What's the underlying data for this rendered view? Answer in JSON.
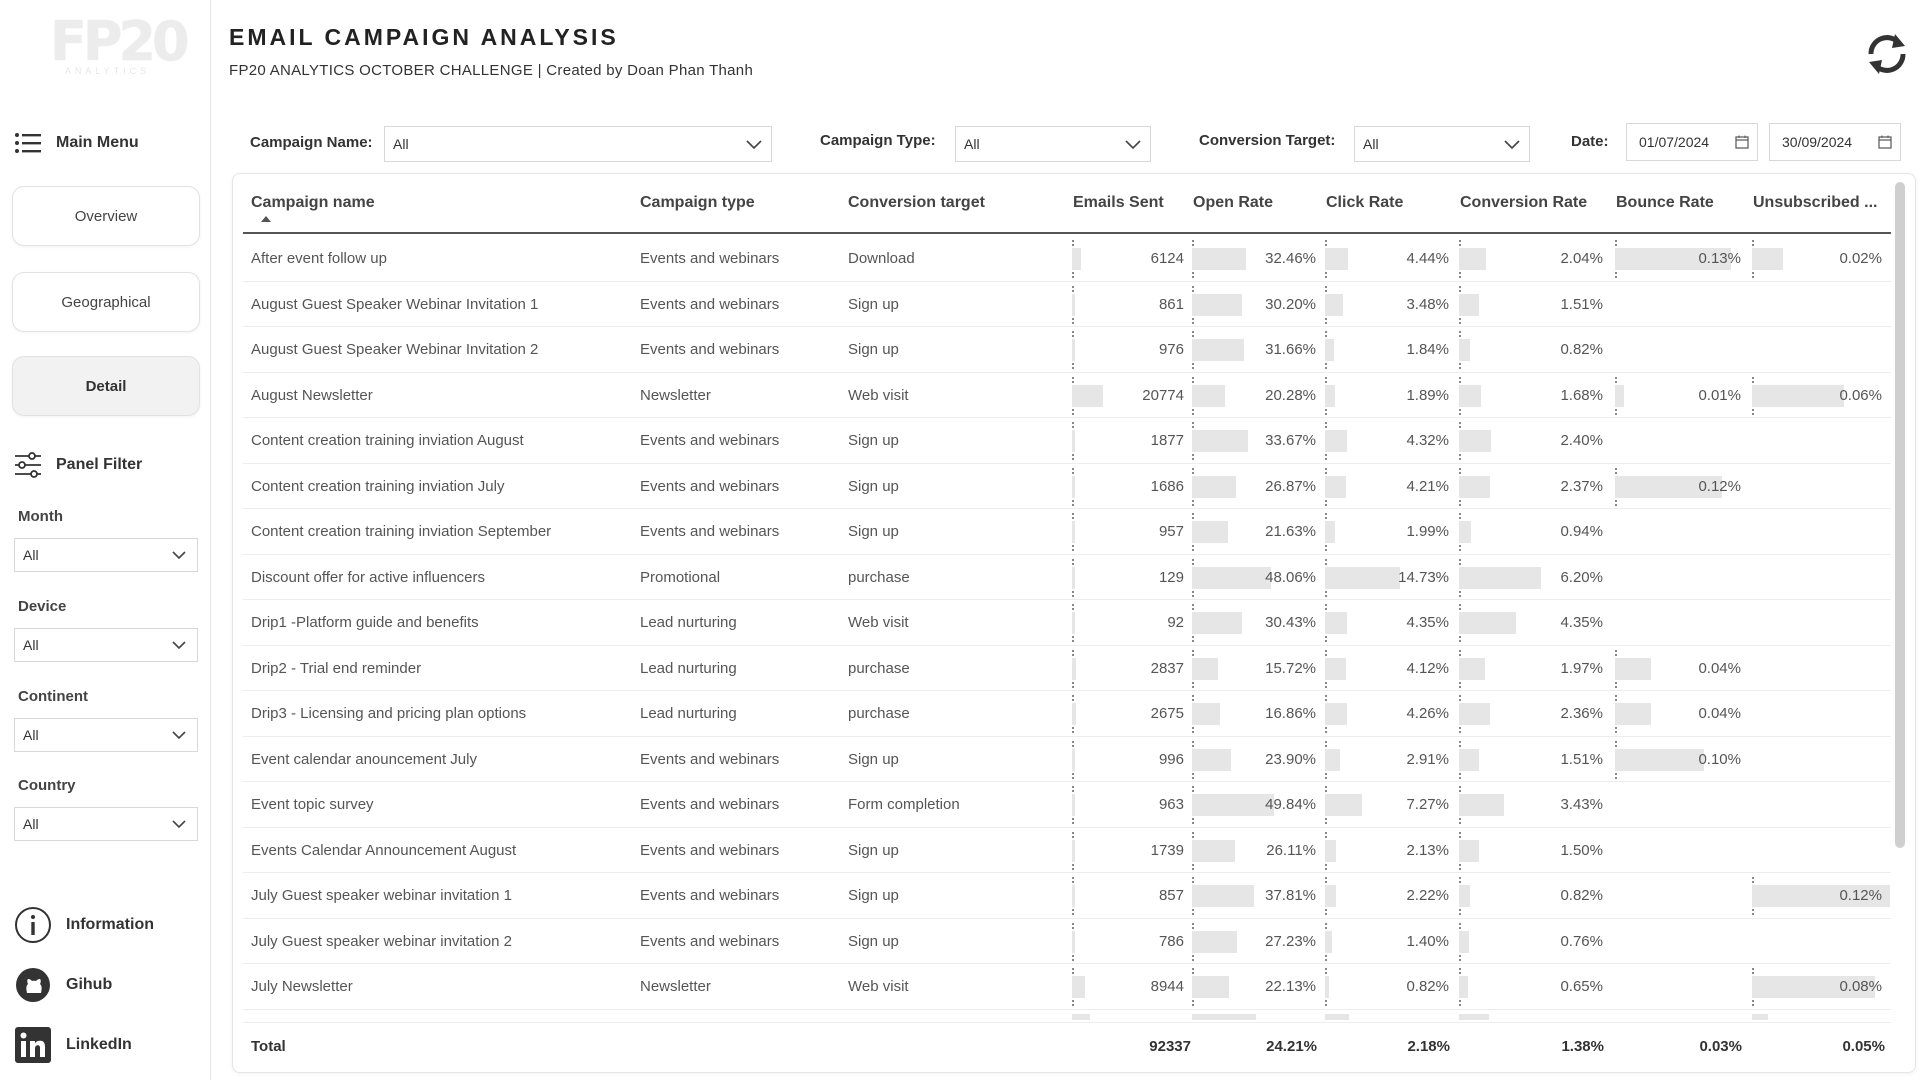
{
  "header": {
    "logo_text": "FP20",
    "logo_sub": "ANALYTICS",
    "title": "EMAIL CAMPAIGN ANALYSIS",
    "subtitle": "FP20 ANALYTICS OCTOBER CHALLENGE | Created by Doan Phan Thanh",
    "refresh_icon": "refresh-icon"
  },
  "sidebar": {
    "main_menu": "Main Menu",
    "nav": [
      {
        "label": "Overview",
        "active": false
      },
      {
        "label": "Geographical",
        "active": false
      },
      {
        "label": "Detail",
        "active": true
      }
    ],
    "panel_filter": "Panel Filter",
    "filters": [
      {
        "label": "Month",
        "value": "All"
      },
      {
        "label": "Device",
        "value": "All"
      },
      {
        "label": "Continent",
        "value": "All"
      },
      {
        "label": "Country",
        "value": "All"
      }
    ],
    "links": [
      {
        "label": "Information",
        "icon": "info-icon"
      },
      {
        "label": "Gihub",
        "icon": "github-icon"
      },
      {
        "label": "LinkedIn",
        "icon": "linkedin-icon"
      }
    ]
  },
  "filterbar": {
    "campaign_name_label": "Campaign Name:",
    "campaign_name_value": "All",
    "campaign_type_label": "Campaign Type:",
    "campaign_type_value": "All",
    "conversion_target_label": "Conversion Target:",
    "conversion_target_value": "All",
    "date_label": "Date:",
    "date_from": "01/07/2024",
    "date_to": "30/09/2024"
  },
  "table": {
    "columns": [
      "Campaign name",
      "Campaign type",
      "Conversion target",
      "Emails Sent",
      "Open Rate",
      "Click Rate",
      "Conversion Rate",
      "Bounce Rate",
      "Unsubscribed ..."
    ],
    "rows": [
      {
        "name": "After event follow up",
        "type": "Events and webinars",
        "target": "Download",
        "sent": 6124,
        "sent_t": "6124",
        "open": 32.46,
        "open_t": "32.46%",
        "click": 4.44,
        "click_t": "4.44%",
        "conv": 2.04,
        "conv_t": "2.04%",
        "bounce": 0.13,
        "bounce_t": "0.13%",
        "unsub": 0.02,
        "unsub_t": "0.02%"
      },
      {
        "name": "August Guest Speaker Webinar Invitation 1",
        "type": "Events and webinars",
        "target": "Sign up",
        "sent": 861,
        "sent_t": "861",
        "open": 30.2,
        "open_t": "30.20%",
        "click": 3.48,
        "click_t": "3.48%",
        "conv": 1.51,
        "conv_t": "1.51%",
        "bounce": null,
        "bounce_t": "",
        "unsub": null,
        "unsub_t": ""
      },
      {
        "name": "August Guest Speaker Webinar Invitation 2",
        "type": "Events and webinars",
        "target": "Sign up",
        "sent": 976,
        "sent_t": "976",
        "open": 31.66,
        "open_t": "31.66%",
        "click": 1.84,
        "click_t": "1.84%",
        "conv": 0.82,
        "conv_t": "0.82%",
        "bounce": null,
        "bounce_t": "",
        "unsub": null,
        "unsub_t": ""
      },
      {
        "name": "August Newsletter",
        "type": "Newsletter",
        "target": "Web visit",
        "sent": 20774,
        "sent_t": "20774",
        "open": 20.28,
        "open_t": "20.28%",
        "click": 1.89,
        "click_t": "1.89%",
        "conv": 1.68,
        "conv_t": "1.68%",
        "bounce": 0.01,
        "bounce_t": "0.01%",
        "unsub": 0.06,
        "unsub_t": "0.06%"
      },
      {
        "name": "Content creation training inviation August",
        "type": "Events and webinars",
        "target": "Sign up",
        "sent": 1877,
        "sent_t": "1877",
        "open": 33.67,
        "open_t": "33.67%",
        "click": 4.32,
        "click_t": "4.32%",
        "conv": 2.4,
        "conv_t": "2.40%",
        "bounce": null,
        "bounce_t": "",
        "unsub": null,
        "unsub_t": ""
      },
      {
        "name": "Content creation training inviation July",
        "type": "Events and webinars",
        "target": "Sign up",
        "sent": 1686,
        "sent_t": "1686",
        "open": 26.87,
        "open_t": "26.87%",
        "click": 4.21,
        "click_t": "4.21%",
        "conv": 2.37,
        "conv_t": "2.37%",
        "bounce": 0.12,
        "bounce_t": "0.12%",
        "unsub": null,
        "unsub_t": ""
      },
      {
        "name": "Content creation training inviation September",
        "type": "Events and webinars",
        "target": "Sign up",
        "sent": 957,
        "sent_t": "957",
        "open": 21.63,
        "open_t": "21.63%",
        "click": 1.99,
        "click_t": "1.99%",
        "conv": 0.94,
        "conv_t": "0.94%",
        "bounce": null,
        "bounce_t": "",
        "unsub": null,
        "unsub_t": ""
      },
      {
        "name": "Discount offer for active influencers",
        "type": "Promotional",
        "target": "purchase",
        "sent": 129,
        "sent_t": "129",
        "open": 48.06,
        "open_t": "48.06%",
        "click": 14.73,
        "click_t": "14.73%",
        "conv": 6.2,
        "conv_t": "6.20%",
        "bounce": null,
        "bounce_t": "",
        "unsub": null,
        "unsub_t": ""
      },
      {
        "name": "Drip1 -Platform guide and benefits",
        "type": "Lead nurturing",
        "target": "Web visit",
        "sent": 92,
        "sent_t": "92",
        "open": 30.43,
        "open_t": "30.43%",
        "click": 4.35,
        "click_t": "4.35%",
        "conv": 4.35,
        "conv_t": "4.35%",
        "bounce": null,
        "bounce_t": "",
        "unsub": null,
        "unsub_t": ""
      },
      {
        "name": "Drip2 - Trial end reminder",
        "type": "Lead nurturing",
        "target": "purchase",
        "sent": 2837,
        "sent_t": "2837",
        "open": 15.72,
        "open_t": "15.72%",
        "click": 4.12,
        "click_t": "4.12%",
        "conv": 1.97,
        "conv_t": "1.97%",
        "bounce": 0.04,
        "bounce_t": "0.04%",
        "unsub": null,
        "unsub_t": ""
      },
      {
        "name": "Drip3 - Licensing and pricing plan options",
        "type": "Lead nurturing",
        "target": "purchase",
        "sent": 2675,
        "sent_t": "2675",
        "open": 16.86,
        "open_t": "16.86%",
        "click": 4.26,
        "click_t": "4.26%",
        "conv": 2.36,
        "conv_t": "2.36%",
        "bounce": 0.04,
        "bounce_t": "0.04%",
        "unsub": null,
        "unsub_t": ""
      },
      {
        "name": "Event calendar anouncement July",
        "type": "Events and webinars",
        "target": "Sign up",
        "sent": 996,
        "sent_t": "996",
        "open": 23.9,
        "open_t": "23.90%",
        "click": 2.91,
        "click_t": "2.91%",
        "conv": 1.51,
        "conv_t": "1.51%",
        "bounce": 0.1,
        "bounce_t": "0.10%",
        "unsub": null,
        "unsub_t": ""
      },
      {
        "name": "Event topic survey",
        "type": "Events and webinars",
        "target": "Form completion",
        "sent": 963,
        "sent_t": "963",
        "open": 49.84,
        "open_t": "49.84%",
        "click": 7.27,
        "click_t": "7.27%",
        "conv": 3.43,
        "conv_t": "3.43%",
        "bounce": null,
        "bounce_t": "",
        "unsub": null,
        "unsub_t": ""
      },
      {
        "name": "Events Calendar Announcement August",
        "type": "Events and webinars",
        "target": "Sign up",
        "sent": 1739,
        "sent_t": "1739",
        "open": 26.11,
        "open_t": "26.11%",
        "click": 2.13,
        "click_t": "2.13%",
        "conv": 1.5,
        "conv_t": "1.50%",
        "bounce": null,
        "bounce_t": "",
        "unsub": null,
        "unsub_t": ""
      },
      {
        "name": "July Guest speaker webinar invitation 1",
        "type": "Events and webinars",
        "target": "Sign up",
        "sent": 857,
        "sent_t": "857",
        "open": 37.81,
        "open_t": "37.81%",
        "click": 2.22,
        "click_t": "2.22%",
        "conv": 0.82,
        "conv_t": "0.82%",
        "bounce": null,
        "bounce_t": "",
        "unsub": 0.12,
        "unsub_t": "0.12%"
      },
      {
        "name": "July Guest speaker webinar invitation 2",
        "type": "Events and webinars",
        "target": "Sign up",
        "sent": 786,
        "sent_t": "786",
        "open": 27.23,
        "open_t": "27.23%",
        "click": 1.4,
        "click_t": "1.40%",
        "conv": 0.76,
        "conv_t": "0.76%",
        "bounce": null,
        "bounce_t": "",
        "unsub": null,
        "unsub_t": ""
      },
      {
        "name": "July Newsletter",
        "type": "Newsletter",
        "target": "Web visit",
        "sent": 8944,
        "sent_t": "8944",
        "open": 22.13,
        "open_t": "22.13%",
        "click": 0.82,
        "click_t": "0.82%",
        "conv": 0.65,
        "conv_t": "0.65%",
        "bounce": null,
        "bounce_t": "",
        "unsub": 0.08,
        "unsub_t": "0.08%"
      }
    ],
    "total": {
      "label": "Total",
      "sent": "92337",
      "open": "24.21%",
      "click": "2.18%",
      "conv": "1.38%",
      "bounce": "0.03%",
      "unsub": "0.05%"
    },
    "bar_color": "#e6e6e6"
  }
}
